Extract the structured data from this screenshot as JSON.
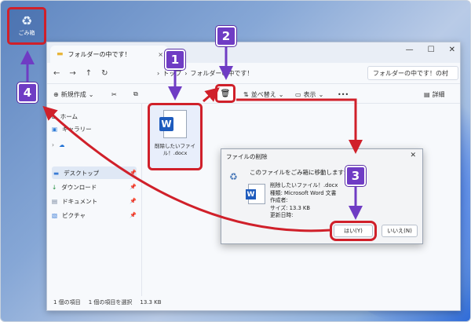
{
  "desktop": {
    "recycle_bin_label": "ごみ箱"
  },
  "window": {
    "tab_title": "フォルダーの中です！",
    "tab_close": "×",
    "new_tab": "+",
    "controls": {
      "minimize": "—",
      "maximize": "☐",
      "close": "✕"
    },
    "nav": {
      "back": "←",
      "forward": "→",
      "up": "↑",
      "refresh": "↻"
    },
    "path": [
      "›",
      "トップ",
      "›",
      "フォルダーの中です！"
    ],
    "search_placeholder": "フォルダーの中です！の村"
  },
  "toolbar": {
    "new": "新規作成",
    "sort": "並べ替え",
    "view": "表示",
    "more": "•••",
    "details": "詳細"
  },
  "sidebar": {
    "items": [
      {
        "label": "ホーム",
        "icon": "home-icon"
      },
      {
        "label": "ギャラリー",
        "icon": "gallery-icon"
      },
      {
        "label": "",
        "icon": "onedrive-icon"
      },
      {
        "label": "デスクトップ",
        "icon": "desktop-folder-icon"
      },
      {
        "label": "ダウンロード",
        "icon": "download-icon"
      },
      {
        "label": "ドキュメント",
        "icon": "documents-icon"
      },
      {
        "label": "ピクチャ",
        "icon": "pictures-icon"
      }
    ]
  },
  "file": {
    "name_line1": "削除したいファイ",
    "name_line2": "ル！.docx"
  },
  "statusbar": {
    "count": "1 個の項目",
    "selected": "1 個の項目を選択",
    "size": "13.3 KB"
  },
  "dialog": {
    "title": "ファイルの削除",
    "close": "✕",
    "question": "このファイルをごみ箱に移動しますか?",
    "info": [
      "削除したいファイル！.docx",
      "種類: Microsoft Word 文書",
      "作成者:",
      "サイズ: 13.3 KB",
      "更新日時:"
    ],
    "yes": "はい(Y)",
    "no": "いいえ(N)"
  },
  "markers": {
    "m1": "1",
    "m2": "2",
    "m3": "3",
    "m4": "4"
  },
  "colors": {
    "highlight": "#d0202a",
    "marker": "#6f3cc4"
  }
}
